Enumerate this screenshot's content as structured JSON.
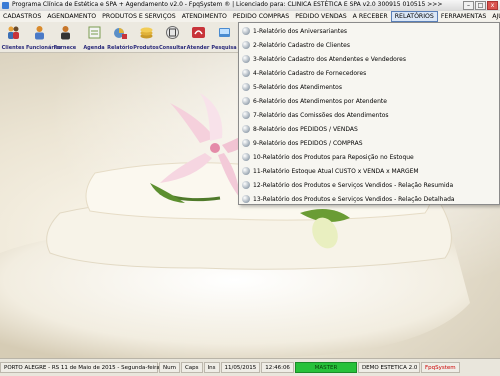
{
  "window": {
    "title": "Programa Clínica de Estética e SPA + Agendamento v2.0 - FpqSystem ® | Licenciado para: CLINICA ESTÉTICA E SPA v2.0 300915 010515 >>>",
    "minimize": "–",
    "maximize": "□",
    "close": "x"
  },
  "menu": [
    "CADASTROS",
    "AGENDAMENTO",
    "PRODUTOS E SERVIÇOS",
    "ATENDIMENTO",
    "PEDIDO COMPRAS",
    "PEDIDO VENDAS",
    "A RECEBER",
    "RELATÓRIOS",
    "FERRAMENTAS",
    "AJUDA"
  ],
  "toolbar": [
    {
      "label": "Clientes",
      "icon": "clients-icon",
      "color": "#e8a23a"
    },
    {
      "label": "Funcionários",
      "icon": "employees-icon",
      "color": "#d98a2b"
    },
    {
      "label": "Fornece",
      "icon": "suppliers-icon",
      "color": "#c7762a"
    },
    {
      "label": "Agenda",
      "icon": "agenda-icon",
      "color": "#7a9c4f"
    },
    {
      "label": "Relatório",
      "icon": "report-icon",
      "color": "#5b8fc7"
    },
    {
      "label": "Produtos",
      "icon": "products-icon",
      "color": "#e0b23a"
    },
    {
      "label": "Consultar",
      "icon": "search-icon",
      "color": "#6d6d6d"
    },
    {
      "label": "Atender",
      "icon": "attend-icon",
      "color": "#c8343a"
    },
    {
      "label": "Pesquisa",
      "icon": "research-icon",
      "color": "#4a8bd0"
    }
  ],
  "reports_menu": [
    "1-Relatório dos Aniversariantes",
    "2-Relatório Cadastro de Clientes",
    "3-Relatório Cadastro dos Atendentes e Vendedores",
    "4-Relatório Cadastro de Fornecedores",
    "5-Relatório dos Atendimentos",
    "6-Relatório dos Atendimentos por Atendente",
    "7-Relatório das Comissões dos Atendimentos",
    "8-Relatório dos PEDIDOS / VENDAS",
    "9-Relatório dos PEDIDOS / COMPRAS",
    "10-Relatório dos Produtos para Reposição no Estoque",
    "11-Relatório Estoque Atual CUSTO x VENDA x MARGEM",
    "12-Relatório dos Produtos e Serviços Vendidos - Relação Resumida",
    "13-Relatório dos Produtos e Serviços Vendidos - Relação Detalhada"
  ],
  "status": {
    "location_date": "PORTO ALEGRE - RS 11 de Maio de 2015 - Segunda-feira",
    "num": "Num",
    "caps": "Caps",
    "ins": "Ins",
    "date": "11/05/2015",
    "time": "12:46:06",
    "user": "MASTER",
    "company": "DEMO ESTETICA 2.0",
    "brand": "FpqSystem"
  }
}
